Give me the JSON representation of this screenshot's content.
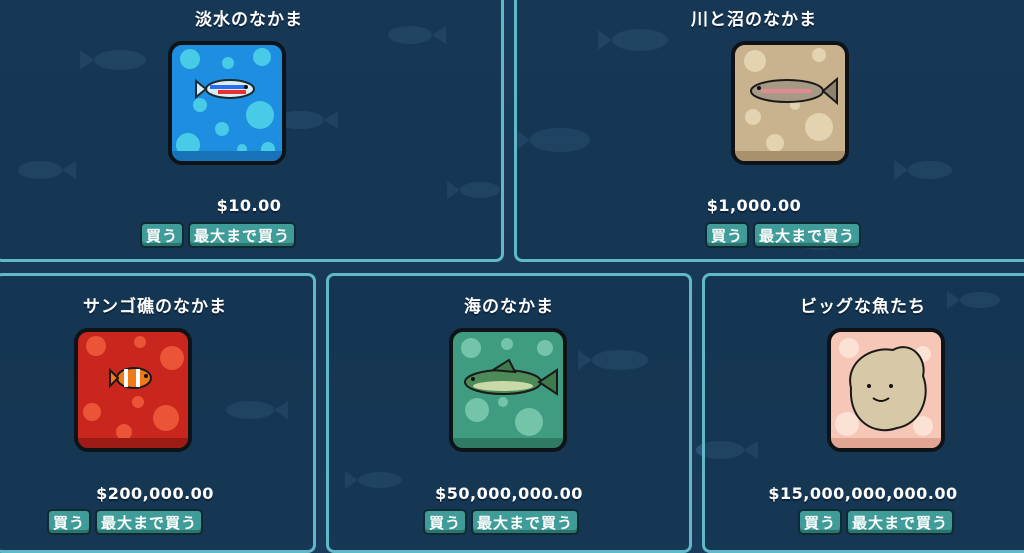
{
  "packs": [
    {
      "title": "淡水のなかま",
      "price": "$10.00",
      "buy": "買う",
      "buy_max": "最大まで買う",
      "card_color": "#1e8fe0",
      "bubble_color": "#4fd6e8",
      "icon": "neon-tetra-icon"
    },
    {
      "title": "川と沼のなかま",
      "price": "$1,000.00",
      "buy": "買う",
      "buy_max": "最大まで買う",
      "card_color": "#c9b38e",
      "bubble_color": "#e6d6b5",
      "icon": "trout-icon"
    },
    {
      "title": "サンゴ礁のなかま",
      "price": "$200,000.00",
      "buy": "買う",
      "buy_max": "最大まで買う",
      "card_color": "#c9261e",
      "bubble_color": "#ef5a3a",
      "icon": "clownfish-icon"
    },
    {
      "title": "海のなかま",
      "price": "$50,000,000.00",
      "buy": "買う",
      "buy_max": "最大まで買う",
      "card_color": "#3f9c80",
      "bubble_color": "#79c9ae",
      "icon": "sea-fish-icon"
    },
    {
      "title": "ビッグな魚たち",
      "price": "$15,000,000,000.00",
      "buy": "買う",
      "buy_max": "最大まで買う",
      "card_color": "#f6c6b6",
      "bubble_color": "#fde4d8",
      "icon": "sunfish-icon"
    }
  ]
}
